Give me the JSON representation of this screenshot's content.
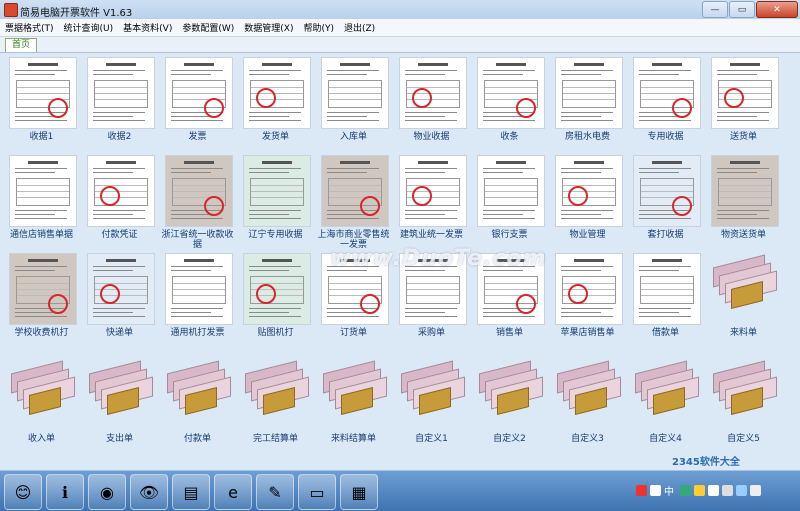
{
  "window": {
    "title": "简易电脑开票软件 V1.63",
    "controls": [
      "—",
      "▭",
      "✕"
    ]
  },
  "menu": [
    "票据格式(T)",
    "统计查询(U)",
    "基本资料(V)",
    "参数配置(W)",
    "数据管理(X)",
    "帮助(Y)",
    "退出(Z)"
  ],
  "tab": "首页",
  "tiles": [
    [
      "收据1",
      "收据2",
      "发票",
      "发货单",
      "入库单",
      "物业收据",
      "收条",
      "房租水电费",
      "专用收据",
      "送货单"
    ],
    [
      "通信店销售单据",
      "付款凭证",
      "浙江省统一收款收据",
      "辽宁专用收据",
      "上海市商业零售统一发票",
      "建筑业统一发票",
      "银行支票",
      "物业管理",
      "套打收据",
      "物资送货单"
    ],
    [
      "学校收费机打",
      "快递单",
      "通用机打发票",
      "贴图机打",
      "订货单",
      "采购单",
      "销售单",
      "苹果店销售单",
      "借款单",
      "来料单"
    ],
    [
      "收入单",
      "支出单",
      "付款单",
      "完工结算单",
      "来料结算单",
      "自定义1",
      "自定义2",
      "自定义3",
      "自定义4",
      "自定义5"
    ]
  ],
  "watermark": "www.DuoTe.com",
  "taskbar": {
    "buttons": [
      "pinned-app-1",
      "info",
      "pdf-reader",
      "eye-viewer",
      "file-manager",
      "ie-browser",
      "image-editor",
      "notepad",
      "invoice-app"
    ],
    "brand": "2345软件大全",
    "ime": "中"
  }
}
